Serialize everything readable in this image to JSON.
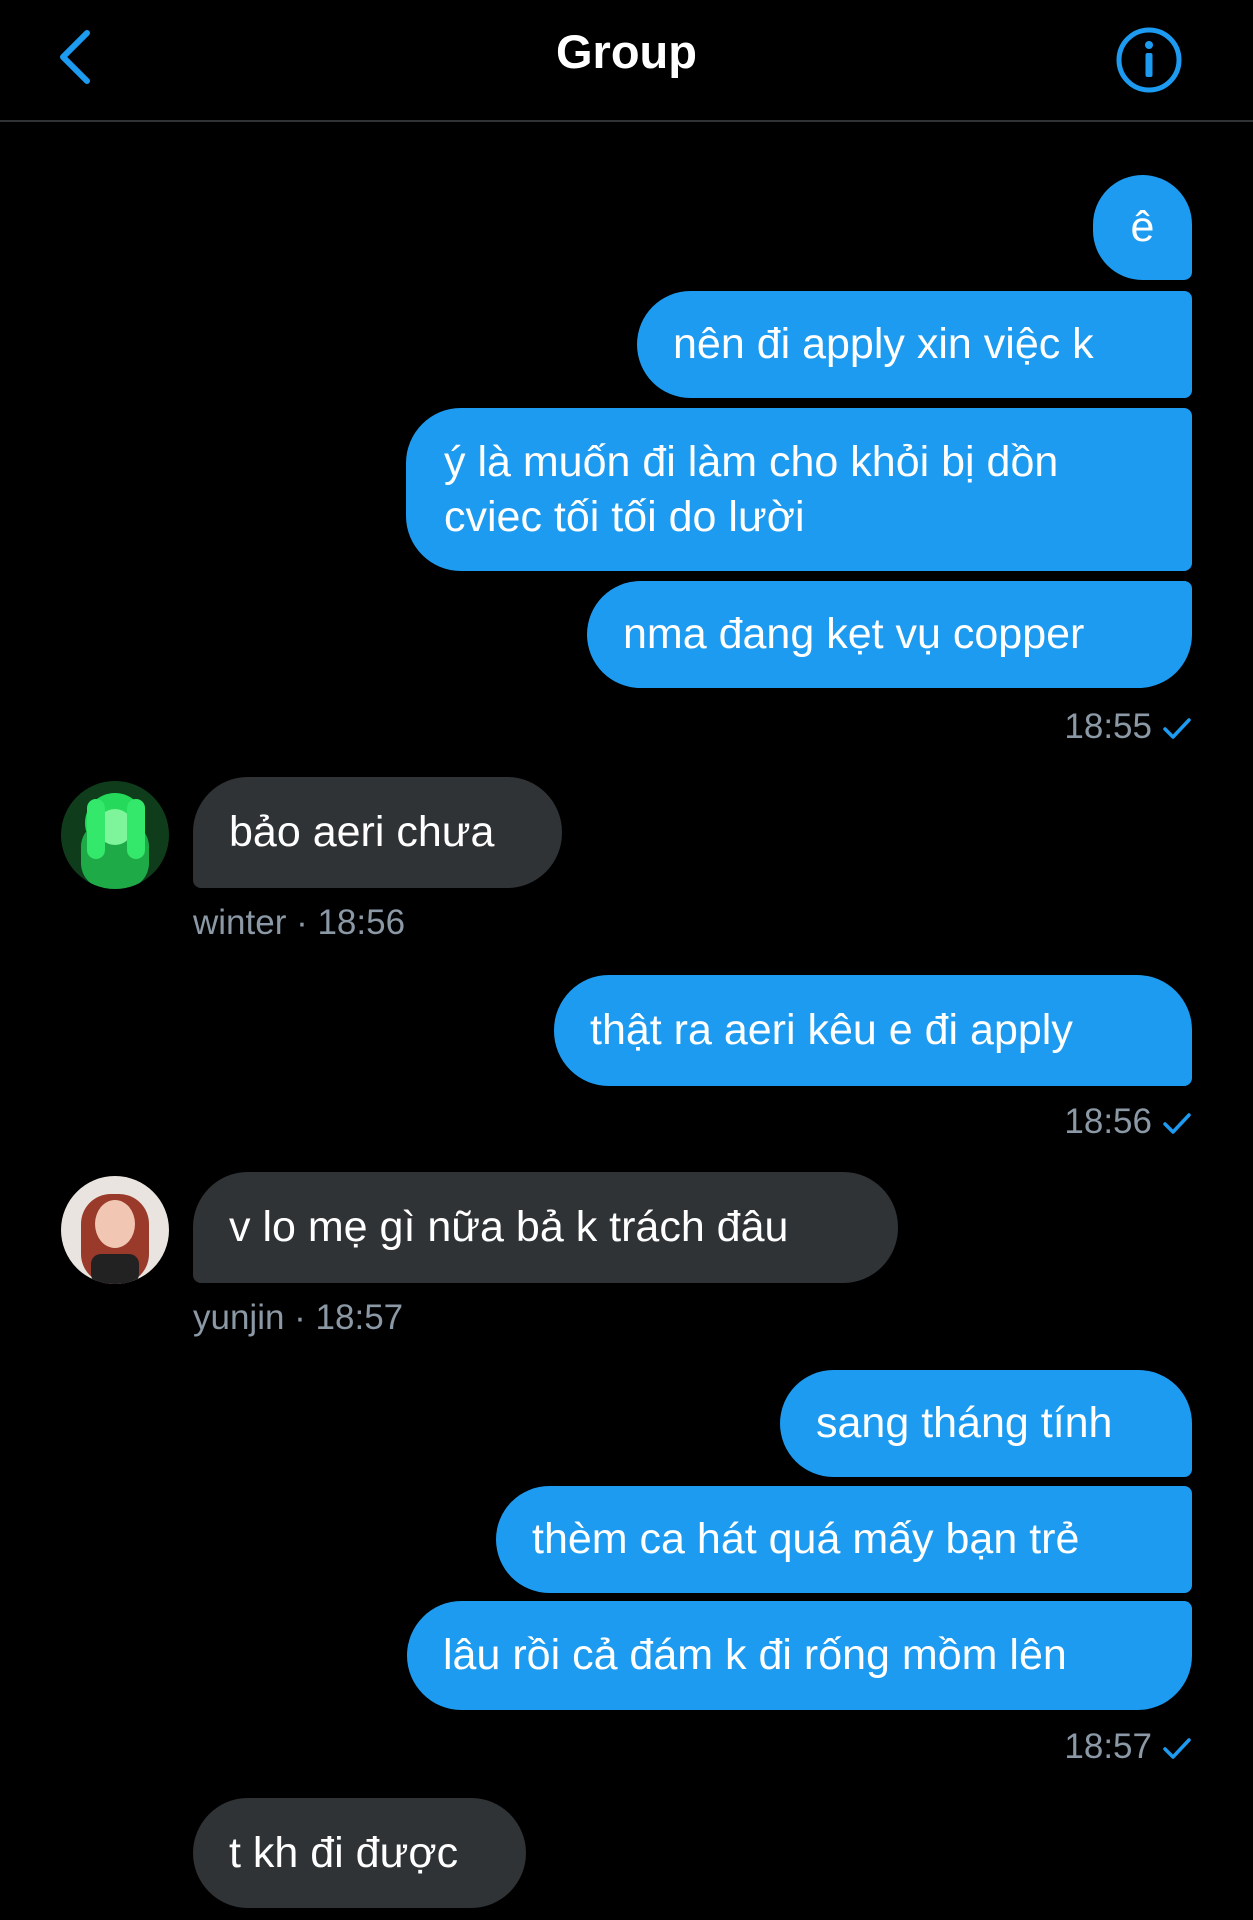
{
  "header": {
    "title": "Group",
    "back_icon": "chevron-left-icon",
    "info_icon": "info-icon",
    "accent": "#1d9bf0"
  },
  "colors": {
    "outgoing": "#1d9bf0",
    "incoming": "#2f3336",
    "meta": "#8b98a5"
  },
  "messages": {
    "m1": "ê",
    "m2": "nên đi apply xin việc k",
    "m3": "ý là muốn đi làm cho khỏi bị dồn cviec tối tối do lười",
    "m4": "nma đang kẹt vụ copper",
    "m4_time": "18:55",
    "m5": "bảo aeri chưa",
    "m5_meta": "winter · 18:56",
    "m6": "thật ra aeri kêu e đi apply",
    "m6_time": "18:56",
    "m7": "v lo mẹ gì nữa bả k trách đâu",
    "m7_meta": "yunjin · 18:57",
    "m8": "sang tháng tính",
    "m9": "thèm ca hát quá mấy bạn trẻ",
    "m10": "lâu rồi cả đám k đi rống mồm lên",
    "m10_time": "18:57",
    "m11": "t kh đi được"
  }
}
